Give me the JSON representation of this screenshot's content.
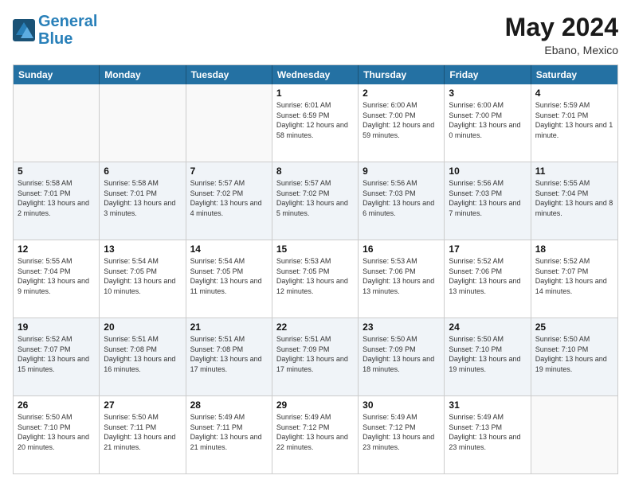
{
  "logo": {
    "text1": "General",
    "text2": "Blue"
  },
  "title": {
    "month_year": "May 2024",
    "location": "Ebano, Mexico"
  },
  "header_days": [
    "Sunday",
    "Monday",
    "Tuesday",
    "Wednesday",
    "Thursday",
    "Friday",
    "Saturday"
  ],
  "weeks": [
    {
      "alt": false,
      "cells": [
        {
          "day": "",
          "empty": true
        },
        {
          "day": "",
          "empty": true
        },
        {
          "day": "",
          "empty": true
        },
        {
          "day": "1",
          "sunrise": "Sunrise: 6:01 AM",
          "sunset": "Sunset: 6:59 PM",
          "daylight": "Daylight: 12 hours and 58 minutes."
        },
        {
          "day": "2",
          "sunrise": "Sunrise: 6:00 AM",
          "sunset": "Sunset: 7:00 PM",
          "daylight": "Daylight: 12 hours and 59 minutes."
        },
        {
          "day": "3",
          "sunrise": "Sunrise: 6:00 AM",
          "sunset": "Sunset: 7:00 PM",
          "daylight": "Daylight: 13 hours and 0 minutes."
        },
        {
          "day": "4",
          "sunrise": "Sunrise: 5:59 AM",
          "sunset": "Sunset: 7:01 PM",
          "daylight": "Daylight: 13 hours and 1 minute."
        }
      ]
    },
    {
      "alt": true,
      "cells": [
        {
          "day": "5",
          "sunrise": "Sunrise: 5:58 AM",
          "sunset": "Sunset: 7:01 PM",
          "daylight": "Daylight: 13 hours and 2 minutes."
        },
        {
          "day": "6",
          "sunrise": "Sunrise: 5:58 AM",
          "sunset": "Sunset: 7:01 PM",
          "daylight": "Daylight: 13 hours and 3 minutes."
        },
        {
          "day": "7",
          "sunrise": "Sunrise: 5:57 AM",
          "sunset": "Sunset: 7:02 PM",
          "daylight": "Daylight: 13 hours and 4 minutes."
        },
        {
          "day": "8",
          "sunrise": "Sunrise: 5:57 AM",
          "sunset": "Sunset: 7:02 PM",
          "daylight": "Daylight: 13 hours and 5 minutes."
        },
        {
          "day": "9",
          "sunrise": "Sunrise: 5:56 AM",
          "sunset": "Sunset: 7:03 PM",
          "daylight": "Daylight: 13 hours and 6 minutes."
        },
        {
          "day": "10",
          "sunrise": "Sunrise: 5:56 AM",
          "sunset": "Sunset: 7:03 PM",
          "daylight": "Daylight: 13 hours and 7 minutes."
        },
        {
          "day": "11",
          "sunrise": "Sunrise: 5:55 AM",
          "sunset": "Sunset: 7:04 PM",
          "daylight": "Daylight: 13 hours and 8 minutes."
        }
      ]
    },
    {
      "alt": false,
      "cells": [
        {
          "day": "12",
          "sunrise": "Sunrise: 5:55 AM",
          "sunset": "Sunset: 7:04 PM",
          "daylight": "Daylight: 13 hours and 9 minutes."
        },
        {
          "day": "13",
          "sunrise": "Sunrise: 5:54 AM",
          "sunset": "Sunset: 7:05 PM",
          "daylight": "Daylight: 13 hours and 10 minutes."
        },
        {
          "day": "14",
          "sunrise": "Sunrise: 5:54 AM",
          "sunset": "Sunset: 7:05 PM",
          "daylight": "Daylight: 13 hours and 11 minutes."
        },
        {
          "day": "15",
          "sunrise": "Sunrise: 5:53 AM",
          "sunset": "Sunset: 7:05 PM",
          "daylight": "Daylight: 13 hours and 12 minutes."
        },
        {
          "day": "16",
          "sunrise": "Sunrise: 5:53 AM",
          "sunset": "Sunset: 7:06 PM",
          "daylight": "Daylight: 13 hours and 13 minutes."
        },
        {
          "day": "17",
          "sunrise": "Sunrise: 5:52 AM",
          "sunset": "Sunset: 7:06 PM",
          "daylight": "Daylight: 13 hours and 13 minutes."
        },
        {
          "day": "18",
          "sunrise": "Sunrise: 5:52 AM",
          "sunset": "Sunset: 7:07 PM",
          "daylight": "Daylight: 13 hours and 14 minutes."
        }
      ]
    },
    {
      "alt": true,
      "cells": [
        {
          "day": "19",
          "sunrise": "Sunrise: 5:52 AM",
          "sunset": "Sunset: 7:07 PM",
          "daylight": "Daylight: 13 hours and 15 minutes."
        },
        {
          "day": "20",
          "sunrise": "Sunrise: 5:51 AM",
          "sunset": "Sunset: 7:08 PM",
          "daylight": "Daylight: 13 hours and 16 minutes."
        },
        {
          "day": "21",
          "sunrise": "Sunrise: 5:51 AM",
          "sunset": "Sunset: 7:08 PM",
          "daylight": "Daylight: 13 hours and 17 minutes."
        },
        {
          "day": "22",
          "sunrise": "Sunrise: 5:51 AM",
          "sunset": "Sunset: 7:09 PM",
          "daylight": "Daylight: 13 hours and 17 minutes."
        },
        {
          "day": "23",
          "sunrise": "Sunrise: 5:50 AM",
          "sunset": "Sunset: 7:09 PM",
          "daylight": "Daylight: 13 hours and 18 minutes."
        },
        {
          "day": "24",
          "sunrise": "Sunrise: 5:50 AM",
          "sunset": "Sunset: 7:10 PM",
          "daylight": "Daylight: 13 hours and 19 minutes."
        },
        {
          "day": "25",
          "sunrise": "Sunrise: 5:50 AM",
          "sunset": "Sunset: 7:10 PM",
          "daylight": "Daylight: 13 hours and 19 minutes."
        }
      ]
    },
    {
      "alt": false,
      "cells": [
        {
          "day": "26",
          "sunrise": "Sunrise: 5:50 AM",
          "sunset": "Sunset: 7:10 PM",
          "daylight": "Daylight: 13 hours and 20 minutes."
        },
        {
          "day": "27",
          "sunrise": "Sunrise: 5:50 AM",
          "sunset": "Sunset: 7:11 PM",
          "daylight": "Daylight: 13 hours and 21 minutes."
        },
        {
          "day": "28",
          "sunrise": "Sunrise: 5:49 AM",
          "sunset": "Sunset: 7:11 PM",
          "daylight": "Daylight: 13 hours and 21 minutes."
        },
        {
          "day": "29",
          "sunrise": "Sunrise: 5:49 AM",
          "sunset": "Sunset: 7:12 PM",
          "daylight": "Daylight: 13 hours and 22 minutes."
        },
        {
          "day": "30",
          "sunrise": "Sunrise: 5:49 AM",
          "sunset": "Sunset: 7:12 PM",
          "daylight": "Daylight: 13 hours and 23 minutes."
        },
        {
          "day": "31",
          "sunrise": "Sunrise: 5:49 AM",
          "sunset": "Sunset: 7:13 PM",
          "daylight": "Daylight: 13 hours and 23 minutes."
        },
        {
          "day": "",
          "empty": true
        }
      ]
    }
  ]
}
